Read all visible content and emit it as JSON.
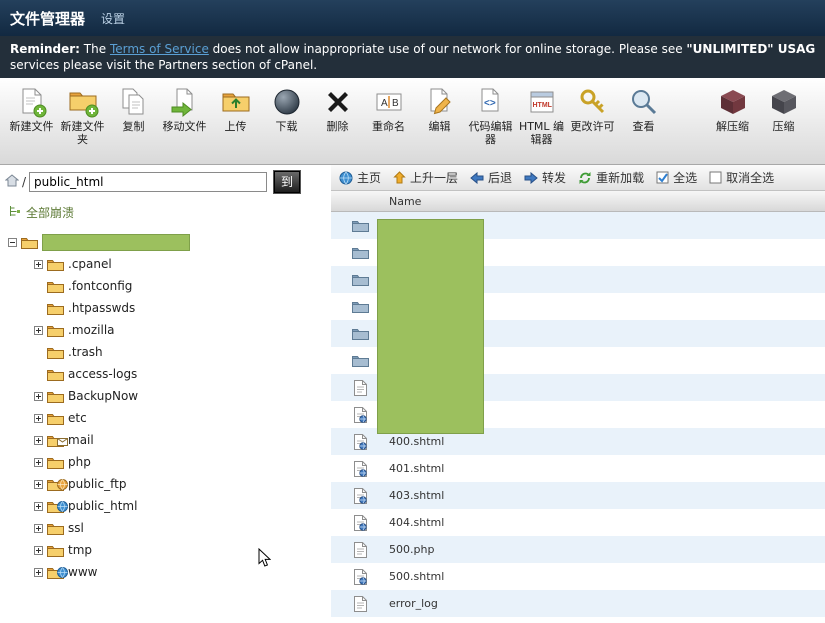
{
  "colors": {
    "header_bg": "#122941",
    "reminder_bg": "#232f3a",
    "link": "#5a9fd4",
    "row_stripe": "#e9f2fa",
    "redaction": "#9cc05e"
  },
  "header": {
    "title": "文件管理器",
    "settings": "设置"
  },
  "reminder": {
    "bold": "Reminder:",
    "t1": " The ",
    "link": "Terms of Service",
    "t2": " does not allow inappropriate use of our network for online storage. Please see ",
    "bold2": "\"UNLIMITED\" USAGE POLIC",
    "line2": "services please visit the Partners section of cPanel."
  },
  "toolbar": {
    "buttons": [
      "新建文件",
      "新建文件夹",
      "复制",
      "移动文件",
      "上传",
      "下载",
      "删除",
      "重命名",
      "编辑",
      "代码编辑器",
      "HTML 编辑器",
      "更改许可",
      "查看",
      "解压缩",
      "压缩"
    ]
  },
  "sidebar": {
    "path_slash": "/",
    "path_value": "public_html",
    "go": "到",
    "collapse_all": "全部崩溃",
    "tree": [
      "",
      ".cpanel",
      ".fontconfig",
      ".htpasswds",
      ".mozilla",
      ".trash",
      "access-logs",
      "BackupNow",
      "etc",
      "mail",
      "php",
      "public_ftp",
      "public_html",
      "ssl",
      "tmp",
      "www"
    ]
  },
  "filelist": {
    "nav": [
      "主页",
      "上升一层",
      "后退",
      "转发",
      "重新加载",
      "全选",
      "取消全选"
    ],
    "header": "Name",
    "rows": [
      "",
      "",
      "",
      "",
      "",
      "",
      "",
      "",
      "400.shtml",
      "401.shtml",
      "403.shtml",
      "404.shtml",
      "500.php",
      "500.shtml",
      "error_log"
    ]
  }
}
